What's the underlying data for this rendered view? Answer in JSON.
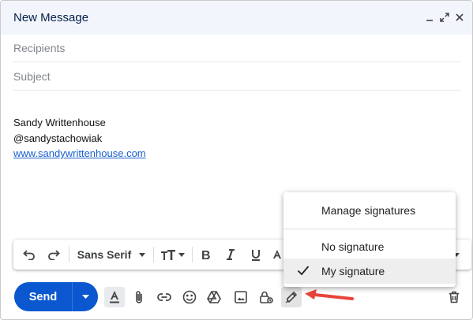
{
  "window": {
    "title": "New Message"
  },
  "compose": {
    "recipients_placeholder": "Recipients",
    "subject_placeholder": "Subject",
    "signature": {
      "name": "Sandy Writtenhouse",
      "handle": "@sandystachowiak",
      "website": "www.sandywrittenhouse.com"
    }
  },
  "formatting": {
    "font": "Sans Serif"
  },
  "send": {
    "label": "Send"
  },
  "signature_menu": {
    "items": [
      {
        "label": "Manage signatures"
      },
      {
        "label": "No signature"
      },
      {
        "label": "My signature",
        "selected": true
      }
    ]
  },
  "colors": {
    "accent": "#0b57d0",
    "arrow": "#e8443a",
    "header_bg": "#f2f6fc"
  }
}
